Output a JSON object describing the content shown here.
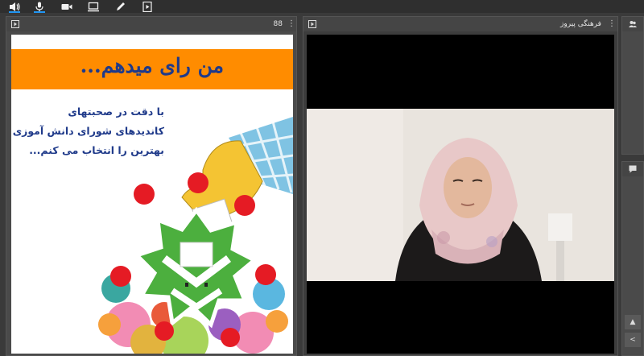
{
  "toolbar": {
    "items": [
      {
        "name": "speaker-icon",
        "active": true
      },
      {
        "name": "microphone-icon",
        "active": true
      },
      {
        "name": "camera-icon",
        "active": false
      },
      {
        "name": "share-screen-icon",
        "active": false
      },
      {
        "name": "draw-icon",
        "active": false
      },
      {
        "name": "content-icon",
        "active": false
      }
    ]
  },
  "share_pod": {
    "page_number": "88",
    "slide": {
      "banner_title": "من رای میدهم...",
      "lines": [
        "با دقت در صحبتهای",
        "کاندیدهای شورای دانش آموزی",
        "بهترین را انتخاب می کنم..."
      ],
      "colors": {
        "banner": "#ff8c00",
        "text": "#1f3a8a",
        "emblem": "#4caf3e"
      }
    }
  },
  "camera_pod": {
    "presenter_name": "فرهنگی پیروز"
  }
}
